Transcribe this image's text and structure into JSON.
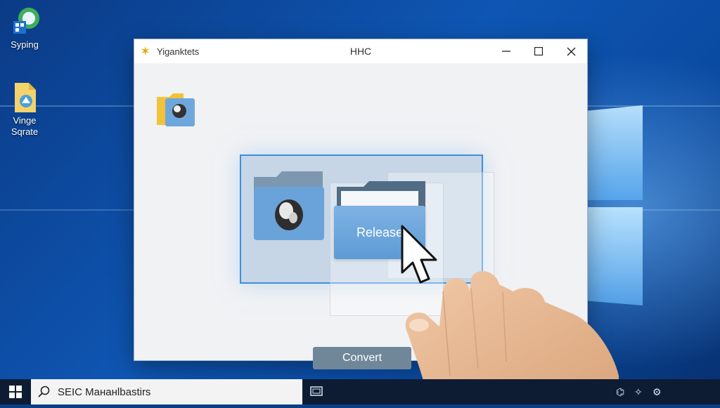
{
  "desktop": {
    "icons": [
      {
        "label": "Syping",
        "icon": "image-app-icon"
      },
      {
        "label": "Vinge Sqrate",
        "icon": "document-icon"
      }
    ]
  },
  "window": {
    "app_name": "Yiganktets",
    "title": "HHC",
    "controls": {
      "minimize": "minimize-icon",
      "maximize": "maximize-icon",
      "close": "close-icon"
    }
  },
  "content": {
    "release_label": "Release",
    "convert_label": "Convert"
  },
  "taskbar": {
    "search_text": "SEIC  Mананlbastirs"
  },
  "colors": {
    "selection_border": "#3e8ede",
    "release_button": "#6aa3da",
    "convert_button": "#6f8799",
    "taskbar": "#0d1c33",
    "wallpaper": "#0e56b3"
  }
}
